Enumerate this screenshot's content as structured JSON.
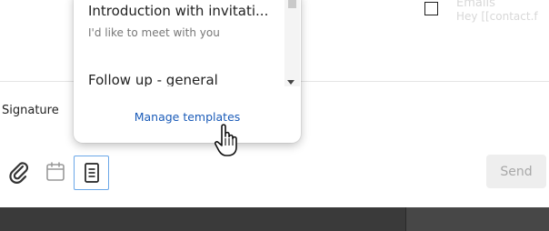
{
  "composer": {
    "signature_label": "Signature",
    "send_label": "Send"
  },
  "toolbar": {
    "icons": [
      "paperclip-icon",
      "calendar-icon",
      "document-icon"
    ]
  },
  "templates_dropdown": {
    "items": [
      {
        "title": "Introduction with invitati...",
        "subtitle": "I'd like to meet with you"
      },
      {
        "title": "Follow up - general",
        "subtitle": ""
      }
    ],
    "manage_label": "Manage templates"
  },
  "background_list": {
    "title": "Emails",
    "snippet": "Hey [[contact.f"
  },
  "colors": {
    "link": "#1a5bb8",
    "send_bg": "#eeeeee",
    "selected_border": "#6aa7e8"
  }
}
